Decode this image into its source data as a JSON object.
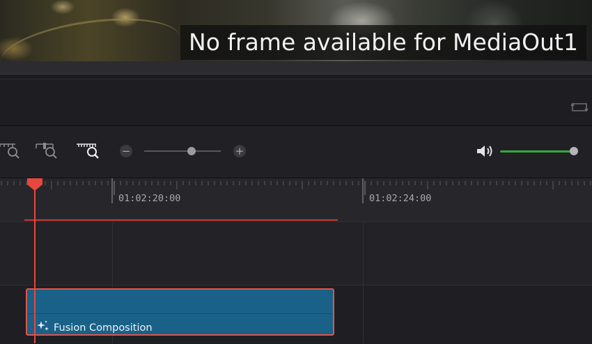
{
  "viewer": {
    "message": "No frame available for MediaOut1"
  },
  "toolbar": {
    "zoom_full_icon": "zoom-to-fit-icon",
    "zoom_detail_icon": "zoom-detail-icon",
    "zoom_custom_icon": "zoom-custom-icon",
    "zoom_out_label": "−",
    "zoom_in_label": "+",
    "zoom_level": 0.62,
    "volume_level": 0.96,
    "volume_color": "#33a937"
  },
  "ruler": {
    "timecodes": [
      "01:02:20:00",
      "01:02:24:00"
    ]
  },
  "timeline": {
    "clip": {
      "label": "Fusion Composition",
      "icon": "fusion-sparkle-icon",
      "color": "#1a6188",
      "selected_border": "#e0554b"
    },
    "playhead_color": "#e8473e"
  }
}
